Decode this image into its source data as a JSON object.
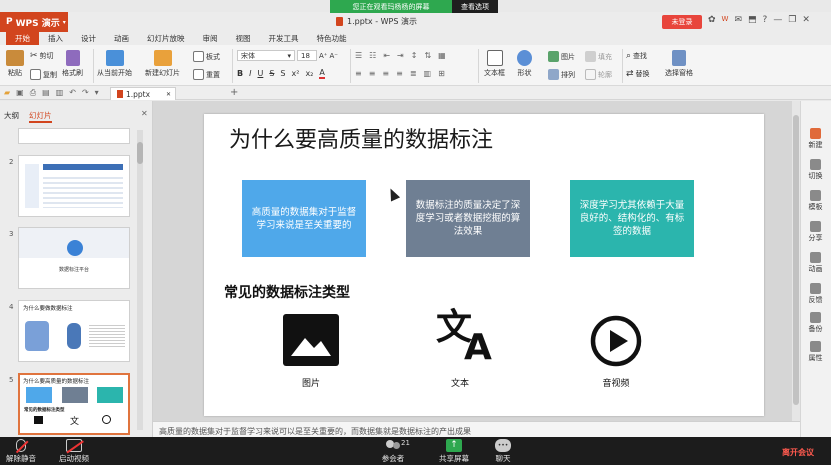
{
  "meeting": {
    "share_banner": "您正在观看玛杨杨的屏幕",
    "view_options": "查看选项",
    "mute_label": "解除静音",
    "video_label": "启动视频",
    "participants_label": "参会者",
    "participants_count": "21",
    "share_label": "共享屏幕",
    "chat_label": "聊天",
    "leave_label": "离开会议"
  },
  "app": {
    "logo": "WPS 演示",
    "title": "1.pptx - WPS 演示",
    "login": "未登录"
  },
  "ribbon_tabs": [
    "开始",
    "插入",
    "设计",
    "动画",
    "幻灯片放映",
    "审阅",
    "视图",
    "开发工具",
    "特色功能"
  ],
  "ribbon": {
    "paste": "粘贴",
    "cut": "剪切",
    "copy": "复制",
    "format_painter": "格式刷",
    "from_current": "从当前开始",
    "new_slide": "新建幻灯片",
    "layout": "板式",
    "reset": "重置",
    "font": "宋体",
    "font_size": "18",
    "text_box": "文本框",
    "shape": "形状",
    "picture": "图片",
    "arrange": "排列",
    "fill": "填充",
    "outline": "轮廓",
    "find": "查找",
    "replace": "替换",
    "select_pane": "选择窗格"
  },
  "doc_tab": "1.pptx",
  "panel": {
    "outline_tab": "大纲",
    "slides_tab": "幻灯片",
    "thumb_numbers": [
      "2",
      "3",
      "4",
      "5"
    ],
    "thumb3_text": "数据标注平台",
    "thumb4_title": "为什么要做数据标注",
    "thumb5_title": "为什么要高质量的数据标注",
    "thumb5_section": "常见的数据标注类型"
  },
  "slide": {
    "title": "为什么要高质量的数据标注",
    "cards": [
      {
        "text": "高质量的数据集对于监督学习来说是至关重要的",
        "color": "#4fa8ea"
      },
      {
        "text": "数据标注的质量决定了深度学习或者数据挖掘的算法效果",
        "color": "#6f7f93"
      },
      {
        "text": "深度学习尤其依赖于大量良好的、结构化的、有标签的数据",
        "color": "#2bb5ad"
      }
    ],
    "section_title": "常见的数据标注类型",
    "icons": [
      {
        "icon": "image-icon",
        "label": "图片"
      },
      {
        "icon": "translate-icon",
        "label": "文本"
      },
      {
        "icon": "play-icon",
        "label": "音视频"
      }
    ]
  },
  "right_pane": [
    "新建",
    "切换",
    "模板",
    "分享",
    "动画",
    "反馈",
    "备份",
    "属性"
  ],
  "notes": "高质量的数据集对于监督学习来说可以是至关重要的，而数据集就是数据标注的产出成果"
}
